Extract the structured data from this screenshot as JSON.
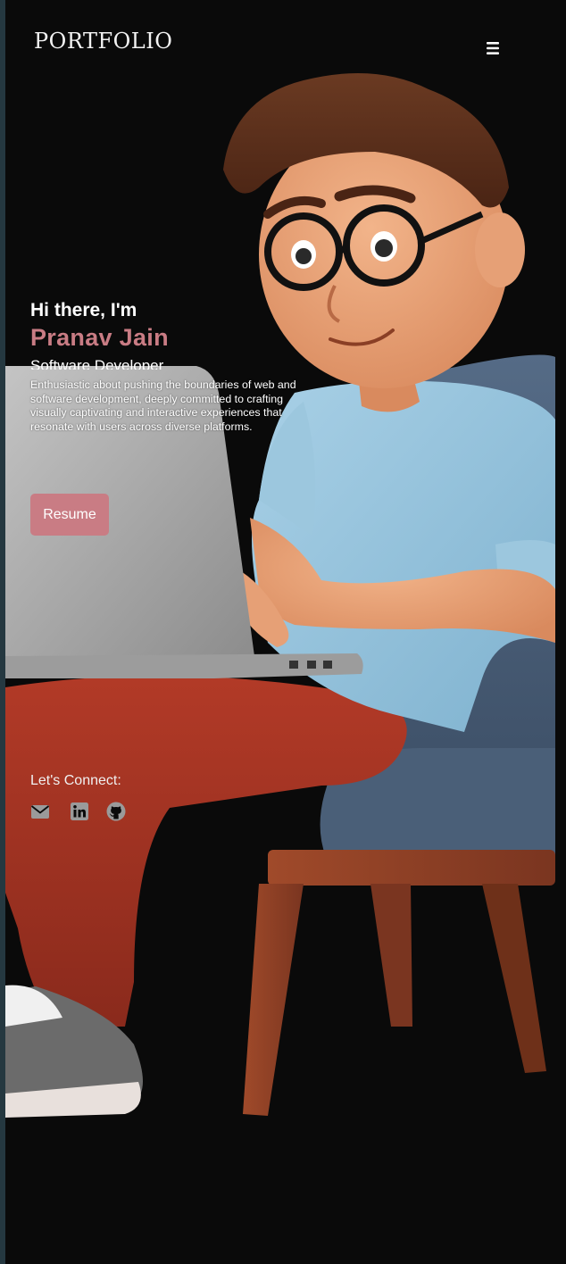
{
  "navbar": {
    "logo": "PORTFOLIO",
    "menu_icon": "hamburger-menu-icon"
  },
  "intro": {
    "greeting": "Hi there, I'm",
    "name": "Pranav Jain",
    "role": "Software Developer",
    "bio": "Enthusiastic about pushing the boundaries of web and software development, deeply committed to crafting visually captivating and interactive experiences that resonate with users across diverse platforms."
  },
  "resume": {
    "label": "Resume"
  },
  "connect": {
    "label": "Let's Connect:",
    "links": [
      {
        "icon": "email-icon"
      },
      {
        "icon": "linkedin-icon"
      },
      {
        "icon": "github-icon"
      }
    ]
  },
  "colors": {
    "background": "#0a0a0a",
    "accent": "#c97c84",
    "text": "#ffffff",
    "icon": "#9a9a9a"
  }
}
